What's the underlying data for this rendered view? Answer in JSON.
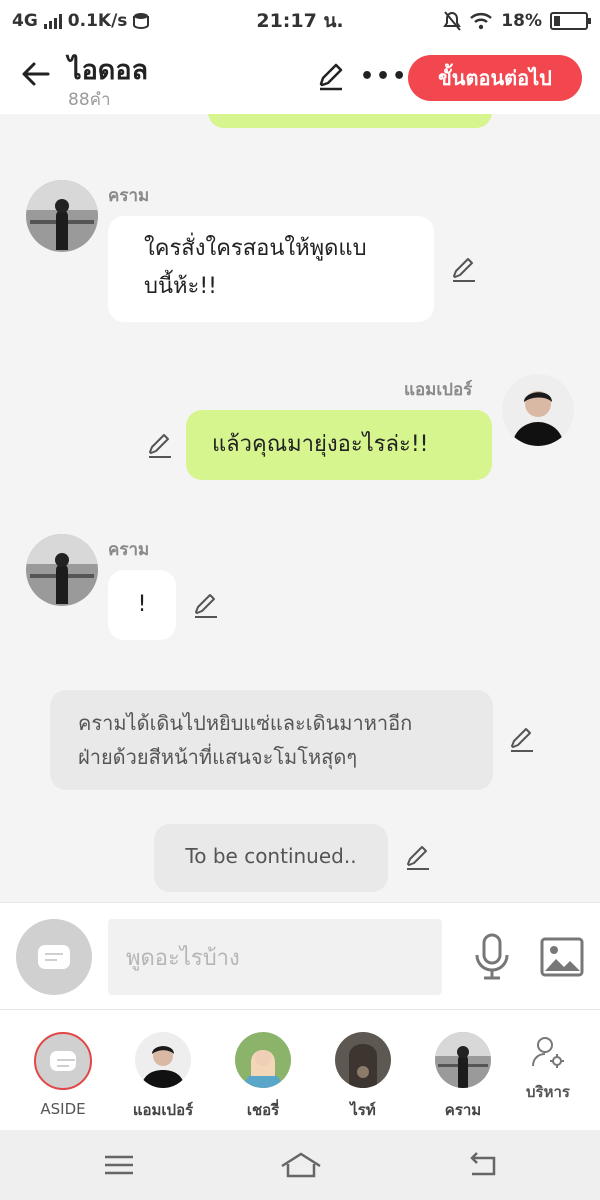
{
  "status": {
    "network": "4G",
    "speed": "0.1K/s",
    "time": "21:17 น.",
    "battery": "18%"
  },
  "header": {
    "title": "ไอดอล",
    "word_count": "88คำ",
    "next_button": "ขั้นตอนต่อไป",
    "accent": "#f3474f"
  },
  "messages": [
    {
      "sender": "คราม",
      "line1": "ใครสั่งใครสอนให้พูดแบ",
      "line2": "บนี้ห้ะ!!"
    },
    {
      "sender": "แอมเปอร์",
      "text": "แล้วคุณมายุ่งอะไรล่ะ!!"
    },
    {
      "sender": "คราม",
      "text": "!"
    },
    {
      "line1": "ครามได้เดินไปหยิบแซ่และเดินมาหาอีก",
      "line2": "ฝ่ายด้วยสีหน้าที่แสนจะโมโหสุดๆ"
    },
    {
      "text": "To be continued.."
    }
  ],
  "composer": {
    "placeholder": "พูดอะไรบ้าง"
  },
  "characters": [
    {
      "label": "ASIDE"
    },
    {
      "label": "แอมเปอร์"
    },
    {
      "label": "เชอรี่"
    },
    {
      "label": "ไรท์"
    },
    {
      "label": "คราม"
    }
  ],
  "manage_label": "บริหาร",
  "colors": {
    "own_bubble": "#d7f58f",
    "other_bubble": "#ffffff",
    "narration_bubble": "#e9e9e9"
  }
}
